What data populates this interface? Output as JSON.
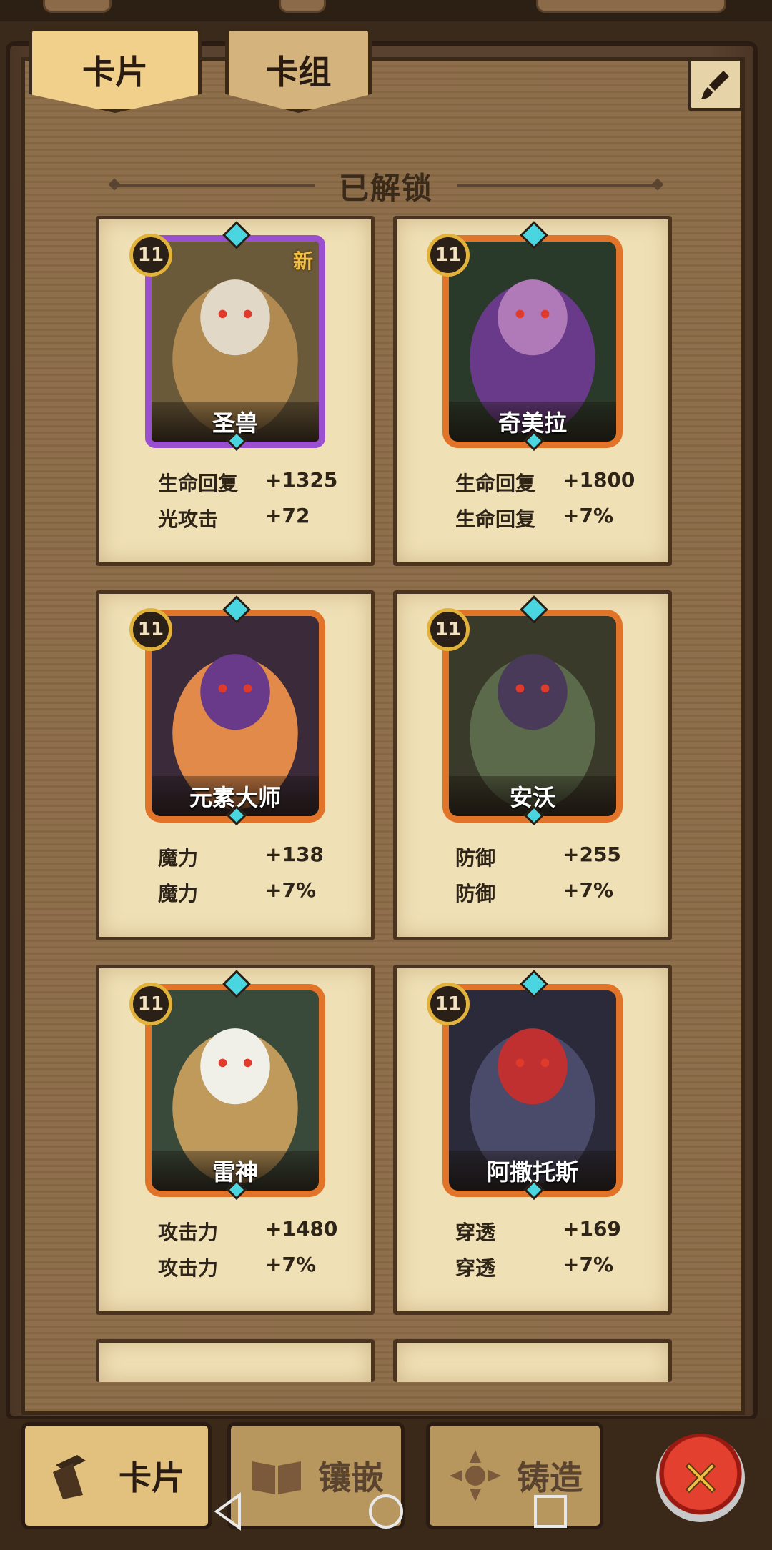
{
  "tabs": {
    "cards": "卡片",
    "decks": "卡组"
  },
  "section": {
    "title": "已解锁"
  },
  "cards": [
    {
      "name": "圣兽",
      "level": "11",
      "badge": "新",
      "frame": "purple",
      "stats": [
        {
          "label": "生命回复",
          "value": "+1325"
        },
        {
          "label": "光攻击",
          "value": "+72"
        }
      ]
    },
    {
      "name": "奇美拉",
      "level": "11",
      "badge": "",
      "frame": "orange",
      "stats": [
        {
          "label": "生命回复",
          "value": "+1800"
        },
        {
          "label": "生命回复",
          "value": "+7%"
        }
      ]
    },
    {
      "name": "元素大师",
      "level": "11",
      "badge": "",
      "frame": "orange",
      "stats": [
        {
          "label": "魔力",
          "value": "+138"
        },
        {
          "label": "魔力",
          "value": "+7%"
        }
      ]
    },
    {
      "name": "安沃",
      "level": "11",
      "badge": "",
      "frame": "orange",
      "stats": [
        {
          "label": "防御",
          "value": "+255"
        },
        {
          "label": "防御",
          "value": "+7%"
        }
      ]
    },
    {
      "name": "雷神",
      "level": "11",
      "badge": "",
      "frame": "orange",
      "stats": [
        {
          "label": "攻击力",
          "value": "+1480"
        },
        {
          "label": "攻击力",
          "value": "+7%"
        }
      ]
    },
    {
      "name": "阿撒托斯",
      "level": "11",
      "badge": "",
      "frame": "orange",
      "stats": [
        {
          "label": "穿透",
          "value": "+169"
        },
        {
          "label": "穿透",
          "value": "+7%"
        }
      ]
    }
  ],
  "bottom_nav": {
    "cards": "卡片",
    "inlay": "镶嵌",
    "forge": "铸造"
  },
  "colors": {
    "parchment": "#f0e0b6",
    "orange_frame": "#e2742a",
    "purple_frame": "#9a4fd0",
    "gem": "#4ad6e0"
  },
  "icons": {
    "edit": "brush-icon",
    "close": "close-x-icon",
    "nav_cards": "cards-icon",
    "nav_inlay": "book-icon",
    "nav_forge": "forge-icon"
  }
}
